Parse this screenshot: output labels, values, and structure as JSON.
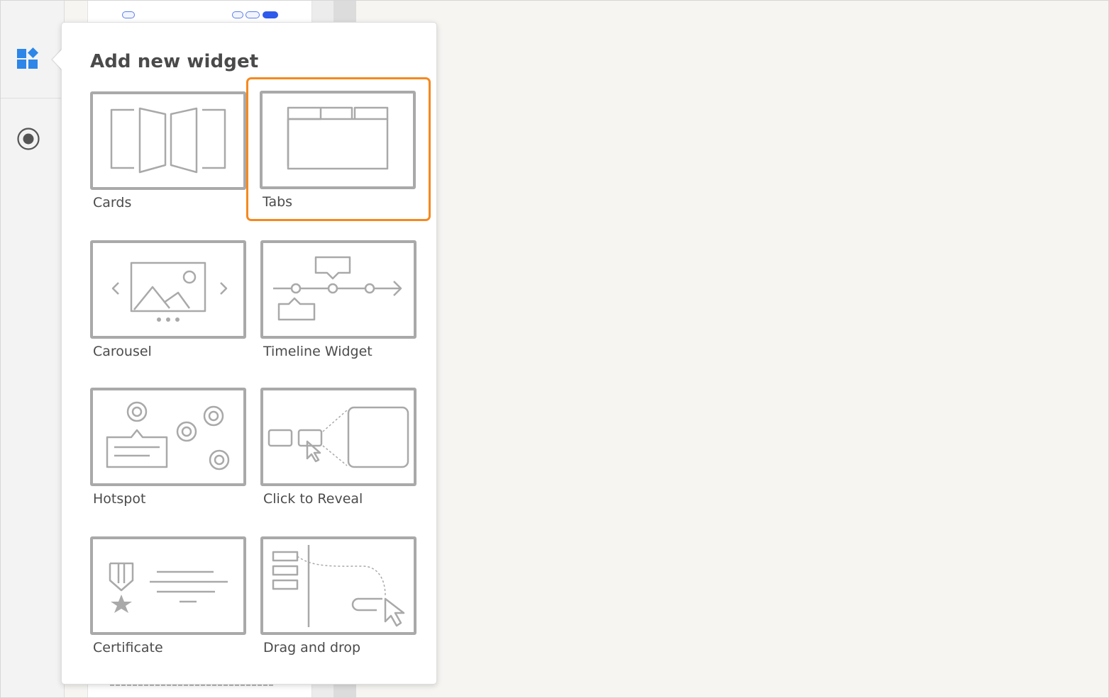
{
  "rail": {
    "icons": [
      "widgets-icon",
      "radio-icon"
    ],
    "accent_color": "#2d86e8"
  },
  "popover": {
    "title": "Add new widget",
    "highlight_color": "#f5891f",
    "widgets": [
      {
        "label": "Cards",
        "icon": "cards-icon",
        "selected": false
      },
      {
        "label": "Tabs",
        "icon": "tabs-icon",
        "selected": true
      },
      {
        "label": "Carousel",
        "icon": "carousel-icon",
        "selected": false
      },
      {
        "label": "Timeline Widget",
        "icon": "timeline-icon",
        "selected": false
      },
      {
        "label": "Hotspot",
        "icon": "hotspot-icon",
        "selected": false
      },
      {
        "label": "Click to Reveal",
        "icon": "click-to-reveal-icon",
        "selected": false
      },
      {
        "label": "Certificate",
        "icon": "certificate-icon",
        "selected": false
      },
      {
        "label": "Drag and drop",
        "icon": "drag-and-drop-icon",
        "selected": false
      }
    ]
  }
}
